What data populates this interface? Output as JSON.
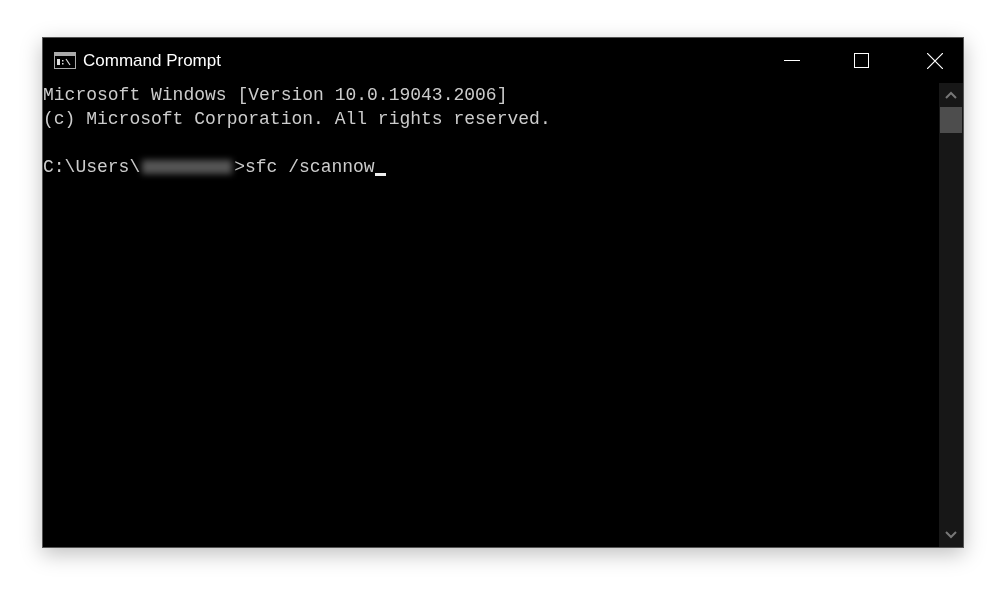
{
  "window": {
    "title": "Command Prompt"
  },
  "console": {
    "output": [
      "Microsoft Windows [Version 10.0.19043.2006]",
      "(c) Microsoft Corporation. All rights reserved."
    ],
    "prompt": {
      "path": "C:\\Users\\",
      "redacted": true,
      "command": ">sfc /scannow",
      "cursor": true
    }
  }
}
